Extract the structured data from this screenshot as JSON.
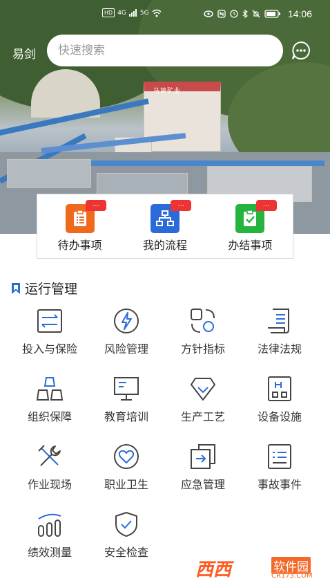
{
  "status_bar": {
    "left_chips": [
      "HD",
      "4G",
      "5G"
    ],
    "time": "14:06"
  },
  "header": {
    "city": "易剑",
    "search_placeholder": "快速搜索",
    "hero_sign": "马坡矿业"
  },
  "quick_actions": [
    {
      "label": "待办事项",
      "badge": "...",
      "color": "#f06a1e",
      "icon": "clipboard-icon"
    },
    {
      "label": "我的流程",
      "badge": "...",
      "color": "#2b6bd9",
      "icon": "flowchart-icon"
    },
    {
      "label": "办结事项",
      "badge": "...",
      "color": "#27b43e",
      "icon": "check-clipboard-icon"
    }
  ],
  "section": {
    "title": "运行管理",
    "accent": "#2b6bd9"
  },
  "grid_items": [
    {
      "label": "投入与保险",
      "icon": "transfer-icon"
    },
    {
      "label": "风险管理",
      "icon": "lightning-icon"
    },
    {
      "label": "方针指标",
      "icon": "shapes-icon"
    },
    {
      "label": "法律法规",
      "icon": "scroll-icon"
    },
    {
      "label": "组织保障",
      "icon": "org-blocks-icon"
    },
    {
      "label": "教育培训",
      "icon": "monitor-icon"
    },
    {
      "label": "生产工艺",
      "icon": "diamond-check-icon"
    },
    {
      "label": "设备设施",
      "icon": "device-icon"
    },
    {
      "label": "作业现场",
      "icon": "wrench-icon"
    },
    {
      "label": "职业卫生",
      "icon": "heart-icon"
    },
    {
      "label": "应急管理",
      "icon": "exit-icon"
    },
    {
      "label": "事故事件",
      "icon": "report-icon"
    },
    {
      "label": "绩效测量",
      "icon": "performance-icon"
    },
    {
      "label": "安全检查",
      "icon": "shield-check-icon"
    }
  ],
  "watermark": {
    "logo": "西西",
    "text": "软件园",
    "url": "CR173.COM"
  }
}
